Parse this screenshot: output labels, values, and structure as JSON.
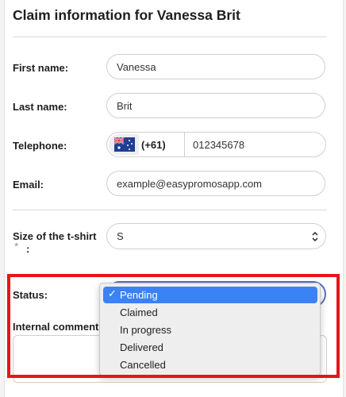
{
  "title": "Claim information for Vanessa Brit",
  "fields": {
    "first_name": {
      "label": "First name:",
      "value": "Vanessa"
    },
    "last_name": {
      "label": "Last name:",
      "value": "Brit"
    },
    "telephone": {
      "label": "Telephone:",
      "country_code": "(+61)",
      "flag": "australia-flag-icon",
      "value": "012345678"
    },
    "email": {
      "label": "Email:",
      "value": "example@easypromosapp.com"
    },
    "tshirt": {
      "label_line1": "Size of the t-shirt",
      "label_required": "*",
      "label_colon": ":",
      "value": "S"
    },
    "status": {
      "label": "Status:",
      "options": [
        "Pending",
        "Claimed",
        "In progress",
        "Delivered",
        "Cancelled"
      ],
      "selected": "Pending",
      "check": "✓"
    },
    "internal_comment": {
      "label": "Internal comment"
    }
  },
  "colors": {
    "highlight": "#e4161c",
    "selected_option": "#3b82f7",
    "focus_border": "#5a6fbf"
  }
}
